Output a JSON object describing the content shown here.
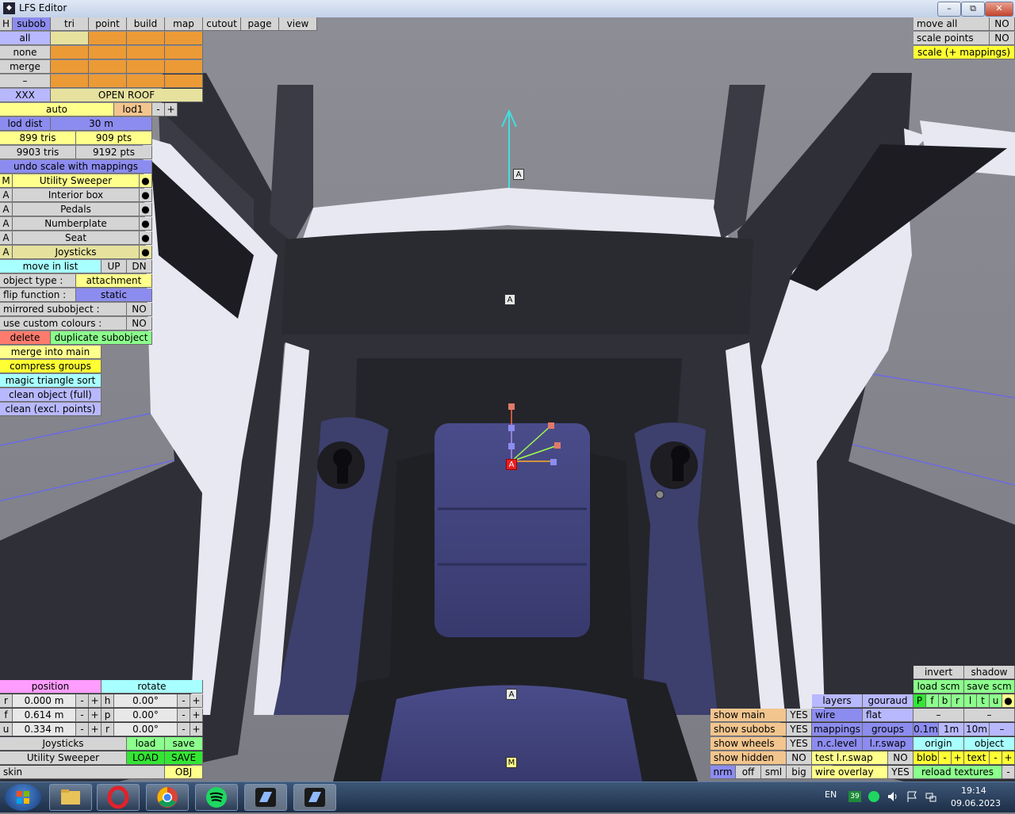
{
  "window": {
    "title": "LFS Editor",
    "minimize": "–",
    "maximize": "⧉",
    "close": "✕"
  },
  "toolbar": {
    "h": "H",
    "tabs": [
      "subob",
      "tri",
      "point",
      "build",
      "map",
      "cutout",
      "page",
      "view"
    ]
  },
  "select": {
    "all": "all",
    "none": "none",
    "merge": "merge",
    "dash": "–",
    "xxx": "XXX",
    "open_roof": "OPEN ROOF"
  },
  "lod": {
    "auto": "auto",
    "lod1": "lod1",
    "minus": "-",
    "plus": "+",
    "lod_dist_label": "lod dist",
    "lod_dist_value": "30 m"
  },
  "stats": {
    "tris": "899 tris",
    "pts": "909 pts",
    "total_tris": "9903 tris",
    "total_pts": "9192 pts"
  },
  "undo": "undo scale with mappings",
  "subobjects": [
    {
      "flag": "M",
      "name": "Utility Sweeper",
      "dot": "●"
    },
    {
      "flag": "A",
      "name": "Interior box",
      "dot": "●"
    },
    {
      "flag": "A",
      "name": "Pedals",
      "dot": "●"
    },
    {
      "flag": "A",
      "name": "Numberplate",
      "dot": "●"
    },
    {
      "flag": "A",
      "name": "Seat",
      "dot": "●"
    },
    {
      "flag": "A",
      "name": "Joysticks",
      "dot": "●"
    }
  ],
  "props": {
    "move_in_list": "move in list",
    "up": "UP",
    "dn": "DN",
    "object_type_label": "object type :",
    "object_type_value": "attachment",
    "flip_label": "flip function :",
    "flip_value": "static",
    "mirrored_label": "mirrored subobject :",
    "mirrored_value": "NO",
    "custom_label": "use custom colours :",
    "custom_value": "NO",
    "delete": "delete",
    "duplicate": "duplicate subobject",
    "merge_into_main": "merge into main",
    "compress_groups": "compress groups",
    "magic_sort": "magic triangle sort",
    "clean_full": "clean object (full)",
    "clean_excl": "clean (excl. points)"
  },
  "top_right": {
    "move_all": "move all",
    "move_all_val": "NO",
    "scale_points": "scale points",
    "scale_points_val": "NO",
    "scale_mappings": "scale (+ mappings)"
  },
  "transform": {
    "position": "position",
    "rotate": "rotate",
    "rows": [
      {
        "axis": "r",
        "value": "0.000 m",
        "raxis": "h",
        "rvalue": "0.00°"
      },
      {
        "axis": "f",
        "value": "0.614 m",
        "raxis": "p",
        "rvalue": "0.00°"
      },
      {
        "axis": "u",
        "value": "0.334 m",
        "raxis": "r",
        "rvalue": "0.00°"
      }
    ],
    "minus": "-",
    "plus": "+",
    "sub_name": "Joysticks",
    "load": "load",
    "save": "save",
    "main_name": "Utility Sweeper",
    "load_caps": "LOAD",
    "save_caps": "SAVE",
    "skin": "skin",
    "obj": "OBJ"
  },
  "view_panel": {
    "invert": "invert",
    "shadow": "shadow",
    "load_scm": "load scm",
    "save_scm": "save scm",
    "letters": [
      "P",
      "f",
      "b",
      "r",
      "l",
      "t",
      "u",
      "●"
    ],
    "dash": "–",
    "show_main": "show main",
    "show_main_val": "YES",
    "show_subobs": "show subobs",
    "show_subobs_val": "YES",
    "show_wheels": "show wheels",
    "show_wheels_val": "YES",
    "show_hidden": "show hidden",
    "show_hidden_val": "NO",
    "nrm": "nrm",
    "off": "off",
    "sml": "sml",
    "big": "big",
    "layers": "layers",
    "gouraud": "gouraud",
    "wire": "wire",
    "flat": "flat",
    "mappings": "mappings",
    "groups": "groups",
    "nc_level": "n.c.level",
    "lr_swap": "l.r.swap",
    "test_lr_swap": "test l.r.swap",
    "test_lr_swap_val": "NO",
    "wire_overlay": "wire overlay",
    "wire_overlay_val": "YES",
    "step1": "0.1m",
    "step2": "1m",
    "step3": "10m",
    "step_minus": "–",
    "origin": "origin",
    "object": "object",
    "blob": "blob",
    "text": "text",
    "reload_textures": "reload textures",
    "minus": "-",
    "plus": "+"
  },
  "scene_labels": {
    "a": "A",
    "m": "M"
  },
  "taskbar": {
    "lang": "EN",
    "badge": "39",
    "time": "19:14",
    "date": "09.06.2023"
  },
  "colors": {
    "accent_blue": "#8c8cf0",
    "yellow": "#ffff8c",
    "orange": "#ec9a36",
    "green": "#8cff8c"
  }
}
